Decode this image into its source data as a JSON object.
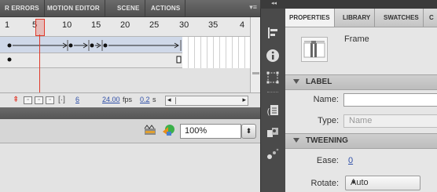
{
  "timeline_panel": {
    "tabs": [
      "R ERRORS",
      "MOTION EDITOR",
      "SCENE",
      "ACTIONS"
    ],
    "ruler_numbers": [
      "1",
      "5",
      "10",
      "15",
      "20",
      "25",
      "30",
      "35",
      "4"
    ],
    "status": {
      "current_frame": "6",
      "fps_value": "24.00",
      "fps_unit": "fps",
      "time_value": "0.2",
      "time_unit": "s"
    }
  },
  "stage_bar": {
    "zoom_value": "100%"
  },
  "properties_panel": {
    "tabs": [
      "PROPERTIES",
      "LIBRARY",
      "SWATCHES",
      "C"
    ],
    "selection_type": "Frame",
    "label_section": {
      "title": "LABEL",
      "name_label": "Name:",
      "name_value": "",
      "type_label": "Type:",
      "type_value": "Name"
    },
    "tweening_section": {
      "title": "TWEENING",
      "ease_label": "Ease:",
      "ease_value": "0",
      "rotate_label": "Rotate:",
      "rotate_value": "Auto"
    }
  },
  "toolbar": {
    "collapse_glyph": "◂◂",
    "icons": [
      "align-icon",
      "info-icon",
      "transform-icon",
      "code-snippets-icon",
      "components-icon",
      "motion-presets-icon"
    ]
  },
  "colors": {
    "playhead": "#e0392b",
    "accent_blue": "#2f4fa8",
    "dark_panel": "#4a4a4a"
  }
}
